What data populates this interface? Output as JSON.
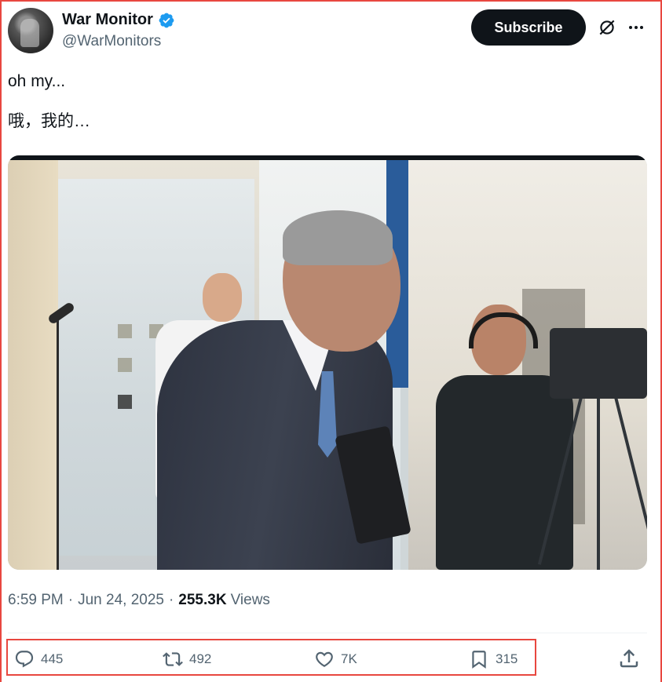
{
  "header": {
    "display_name": "War Monitor",
    "handle": "@WarMonitors",
    "subscribe_label": "Subscribe",
    "verified": true
  },
  "post": {
    "text_line1": "oh my...",
    "text_line2": "哦，我的…",
    "time": "6:59 PM",
    "date": "Jun 24, 2025",
    "views_count": "255.3K",
    "views_label": "Views"
  },
  "actions": {
    "replies": "445",
    "reposts": "492",
    "likes": "7K",
    "bookmarks": "315"
  },
  "colors": {
    "accent_verified": "#1d9bf0",
    "subscribe_bg": "#0f1419",
    "highlight_border": "#e8473f",
    "secondary_text": "#536471"
  },
  "icons": [
    "verified-badge-icon",
    "grok-icon",
    "more-icon",
    "reply-icon",
    "repost-icon",
    "like-icon",
    "bookmark-icon",
    "share-icon"
  ]
}
